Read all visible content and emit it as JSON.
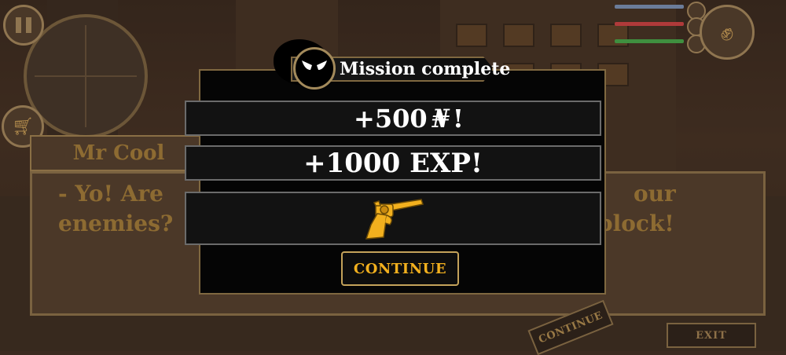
{
  "speaker": {
    "name": "Mr Cool"
  },
  "dialog": {
    "line1_left": "- Yo! Are",
    "line2_left": "enemies?",
    "line1_right": "our",
    "line2_right": "block!"
  },
  "background_buttons": {
    "continue_label": "CONTINUE",
    "exit_label": "EXIT"
  },
  "hud": {
    "bar_colors": [
      "#6b7c99",
      "#b03a3a",
      "#3f8f3f"
    ],
    "icons": [
      "pause-icon",
      "minimap",
      "shop-cart-icon",
      "fist-icon"
    ]
  },
  "modal": {
    "title": "Mission complete",
    "rewards": {
      "money_amount": "+500",
      "money_symbol": "₦",
      "money_suffix": "!",
      "exp": "+1000 EXP!",
      "item_icon": "revolver-icon"
    },
    "continue_label": "CONTINUE"
  },
  "colors": {
    "gold": "#f2b01e",
    "panel": "#050505",
    "border": "#7f6840"
  }
}
